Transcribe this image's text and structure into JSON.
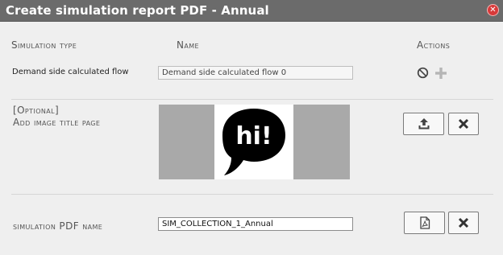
{
  "dialog": {
    "title": "Create simulation report PDF - Annual",
    "close_icon": "close-icon",
    "colors": {
      "titlebar": "#6b6b6b",
      "close": "#d83a3a",
      "background": "#efefef"
    }
  },
  "table": {
    "headers": {
      "type": "Simulation type",
      "name": "Name",
      "actions": "Actions"
    },
    "rows": [
      {
        "type": "Demand side calculated flow",
        "name_value": "Demand side calculated flow 0",
        "actions": [
          "ban-icon",
          "plus-icon"
        ]
      }
    ]
  },
  "image_section": {
    "label_line1": "[Optional]",
    "label_line2": "Add image title page",
    "preview_text": "hi!",
    "upload_icon": "upload-icon",
    "remove_icon": "times-icon"
  },
  "pdf_section": {
    "label": "simulation PDF name",
    "value": "SIM_COLLECTION_1_Annual",
    "pdf_icon": "file-pdf-icon",
    "remove_icon": "times-icon"
  }
}
